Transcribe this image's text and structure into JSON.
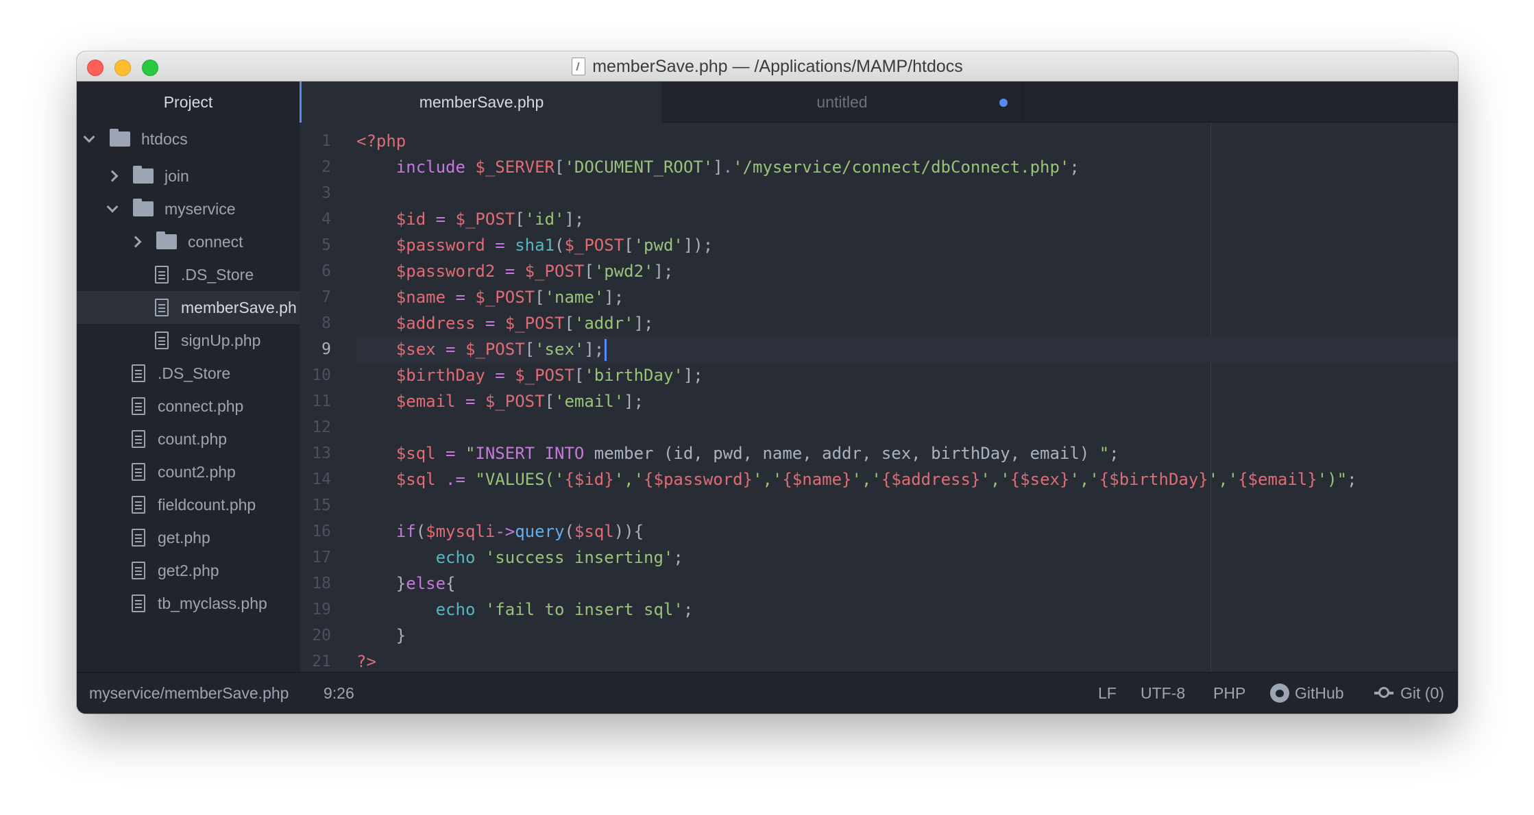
{
  "window": {
    "title": "memberSave.php — /Applications/MAMP/htdocs"
  },
  "sidebar": {
    "header": "Project",
    "items": [
      {
        "label": "htdocs",
        "type": "folder",
        "expanded": true
      },
      {
        "label": "join",
        "type": "folder",
        "expanded": false
      },
      {
        "label": "myservice",
        "type": "folder",
        "expanded": true
      },
      {
        "label": "connect",
        "type": "folder",
        "expanded": false
      },
      {
        "label": ".DS_Store",
        "type": "file"
      },
      {
        "label": "memberSave.ph",
        "type": "file",
        "selected": true
      },
      {
        "label": "signUp.php",
        "type": "file"
      },
      {
        "label": ".DS_Store",
        "type": "file"
      },
      {
        "label": "connect.php",
        "type": "file"
      },
      {
        "label": "count.php",
        "type": "file"
      },
      {
        "label": "count2.php",
        "type": "file"
      },
      {
        "label": "fieldcount.php",
        "type": "file"
      },
      {
        "label": "get.php",
        "type": "file"
      },
      {
        "label": "get2.php",
        "type": "file"
      },
      {
        "label": "tb_myclass.php",
        "type": "file"
      }
    ]
  },
  "tabs": {
    "active": "memberSave.php",
    "inactive": "untitled"
  },
  "editor": {
    "current_line": 9,
    "line_numbers": [
      "1",
      "2",
      "3",
      "4",
      "5",
      "6",
      "7",
      "8",
      "9",
      "10",
      "11",
      "12",
      "13",
      "14",
      "15",
      "16",
      "17",
      "18",
      "19",
      "20",
      "21"
    ],
    "lines": [
      [
        {
          "t": "<?php",
          "c": "v"
        }
      ],
      [
        {
          "t": "    "
        },
        {
          "t": "include",
          "c": "k"
        },
        {
          "t": " "
        },
        {
          "t": "$_SERVER",
          "c": "v"
        },
        {
          "t": "[",
          "c": "p"
        },
        {
          "t": "'DOCUMENT_ROOT'",
          "c": "s"
        },
        {
          "t": "]",
          "c": "p"
        },
        {
          "t": ".",
          "c": "k"
        },
        {
          "t": "'/myservice/connect/dbConnect.php'",
          "c": "s"
        },
        {
          "t": ";",
          "c": "p"
        }
      ],
      [],
      [
        {
          "t": "    "
        },
        {
          "t": "$id",
          "c": "v"
        },
        {
          "t": " = ",
          "c": "k"
        },
        {
          "t": "$_POST",
          "c": "v"
        },
        {
          "t": "[",
          "c": "p"
        },
        {
          "t": "'id'",
          "c": "s"
        },
        {
          "t": "];",
          "c": "p"
        }
      ],
      [
        {
          "t": "    "
        },
        {
          "t": "$password",
          "c": "v"
        },
        {
          "t": " = ",
          "c": "k"
        },
        {
          "t": "sha1",
          "c": "c"
        },
        {
          "t": "(",
          "c": "p"
        },
        {
          "t": "$_POST",
          "c": "v"
        },
        {
          "t": "[",
          "c": "p"
        },
        {
          "t": "'pwd'",
          "c": "s"
        },
        {
          "t": "]);",
          "c": "p"
        }
      ],
      [
        {
          "t": "    "
        },
        {
          "t": "$password2",
          "c": "v"
        },
        {
          "t": " = ",
          "c": "k"
        },
        {
          "t": "$_POST",
          "c": "v"
        },
        {
          "t": "[",
          "c": "p"
        },
        {
          "t": "'pwd2'",
          "c": "s"
        },
        {
          "t": "];",
          "c": "p"
        }
      ],
      [
        {
          "t": "    "
        },
        {
          "t": "$name",
          "c": "v"
        },
        {
          "t": " = ",
          "c": "k"
        },
        {
          "t": "$_POST",
          "c": "v"
        },
        {
          "t": "[",
          "c": "p"
        },
        {
          "t": "'name'",
          "c": "s"
        },
        {
          "t": "];",
          "c": "p"
        }
      ],
      [
        {
          "t": "    "
        },
        {
          "t": "$address",
          "c": "v"
        },
        {
          "t": " = ",
          "c": "k"
        },
        {
          "t": "$_POST",
          "c": "v"
        },
        {
          "t": "[",
          "c": "p"
        },
        {
          "t": "'addr'",
          "c": "s"
        },
        {
          "t": "];",
          "c": "p"
        }
      ],
      [
        {
          "t": "    "
        },
        {
          "t": "$sex",
          "c": "v"
        },
        {
          "t": " = ",
          "c": "k"
        },
        {
          "t": "$_POST",
          "c": "v"
        },
        {
          "t": "[",
          "c": "p"
        },
        {
          "t": "'sex'",
          "c": "s"
        },
        {
          "t": "];",
          "c": "p"
        }
      ],
      [
        {
          "t": "    "
        },
        {
          "t": "$birthDay",
          "c": "v"
        },
        {
          "t": " = ",
          "c": "k"
        },
        {
          "t": "$_POST",
          "c": "v"
        },
        {
          "t": "[",
          "c": "p"
        },
        {
          "t": "'birthDay'",
          "c": "s"
        },
        {
          "t": "];",
          "c": "p"
        }
      ],
      [
        {
          "t": "    "
        },
        {
          "t": "$email",
          "c": "v"
        },
        {
          "t": " = ",
          "c": "k"
        },
        {
          "t": "$_POST",
          "c": "v"
        },
        {
          "t": "[",
          "c": "p"
        },
        {
          "t": "'email'",
          "c": "s"
        },
        {
          "t": "];",
          "c": "p"
        }
      ],
      [],
      [
        {
          "t": "    "
        },
        {
          "t": "$sql",
          "c": "v"
        },
        {
          "t": " = ",
          "c": "k"
        },
        {
          "t": "\"",
          "c": "s"
        },
        {
          "t": "INSERT INTO",
          "c": "k"
        },
        {
          "t": " member (id, pwd, name, addr, sex, birthDay, email) ",
          "c": "p"
        },
        {
          "t": "\"",
          "c": "s"
        },
        {
          "t": ";",
          "c": "p"
        }
      ],
      [
        {
          "t": "    "
        },
        {
          "t": "$sql",
          "c": "v"
        },
        {
          "t": " .= ",
          "c": "k"
        },
        {
          "t": "\"VALUES('",
          "c": "s"
        },
        {
          "t": "{$id}",
          "c": "v"
        },
        {
          "t": "','",
          "c": "s"
        },
        {
          "t": "{$password}",
          "c": "v"
        },
        {
          "t": "','",
          "c": "s"
        },
        {
          "t": "{$name}",
          "c": "v"
        },
        {
          "t": "','",
          "c": "s"
        },
        {
          "t": "{$address}",
          "c": "v"
        },
        {
          "t": "','",
          "c": "s"
        },
        {
          "t": "{$sex}",
          "c": "v"
        },
        {
          "t": "','",
          "c": "s"
        },
        {
          "t": "{$birthDay}",
          "c": "v"
        },
        {
          "t": "','",
          "c": "s"
        },
        {
          "t": "{$email}",
          "c": "v"
        },
        {
          "t": "')\"",
          "c": "s"
        },
        {
          "t": ";",
          "c": "p"
        }
      ],
      [],
      [
        {
          "t": "    "
        },
        {
          "t": "if",
          "c": "k"
        },
        {
          "t": "(",
          "c": "p"
        },
        {
          "t": "$mysqli",
          "c": "v"
        },
        {
          "t": "->",
          "c": "k"
        },
        {
          "t": "query",
          "c": "f"
        },
        {
          "t": "(",
          "c": "p"
        },
        {
          "t": "$sql",
          "c": "v"
        },
        {
          "t": ")){",
          "c": "p"
        }
      ],
      [
        {
          "t": "        "
        },
        {
          "t": "echo",
          "c": "c"
        },
        {
          "t": " "
        },
        {
          "t": "'success inserting'",
          "c": "s"
        },
        {
          "t": ";",
          "c": "p"
        }
      ],
      [
        {
          "t": "    "
        },
        {
          "t": "}",
          "c": "p"
        },
        {
          "t": "else",
          "c": "k"
        },
        {
          "t": "{",
          "c": "p"
        }
      ],
      [
        {
          "t": "        "
        },
        {
          "t": "echo",
          "c": "c"
        },
        {
          "t": " "
        },
        {
          "t": "'fail to insert sql'",
          "c": "s"
        },
        {
          "t": ";",
          "c": "p"
        }
      ],
      [
        {
          "t": "    "
        },
        {
          "t": "}",
          "c": "p"
        }
      ],
      [
        {
          "t": "?>",
          "c": "v"
        }
      ]
    ]
  },
  "statusbar": {
    "path": "myservice/memberSave.php",
    "cursor": "9:26",
    "line_ending": "LF",
    "encoding": "UTF-8",
    "grammar": "PHP",
    "github": "GitHub",
    "git": "Git (0)"
  },
  "colors": {
    "accent": "#568af2",
    "background": "#282c34",
    "sidebar": "#21252b",
    "keyword": "#c678dd",
    "variable": "#e06c75",
    "string": "#98c379",
    "function": "#61afef",
    "builtin": "#56b6c2"
  },
  "icons": [
    "close-button",
    "minimize-button",
    "maximize-button",
    "file-icon",
    "folder-icon",
    "chevron-down-icon",
    "chevron-right-icon",
    "github-icon",
    "git-commit-icon"
  ]
}
